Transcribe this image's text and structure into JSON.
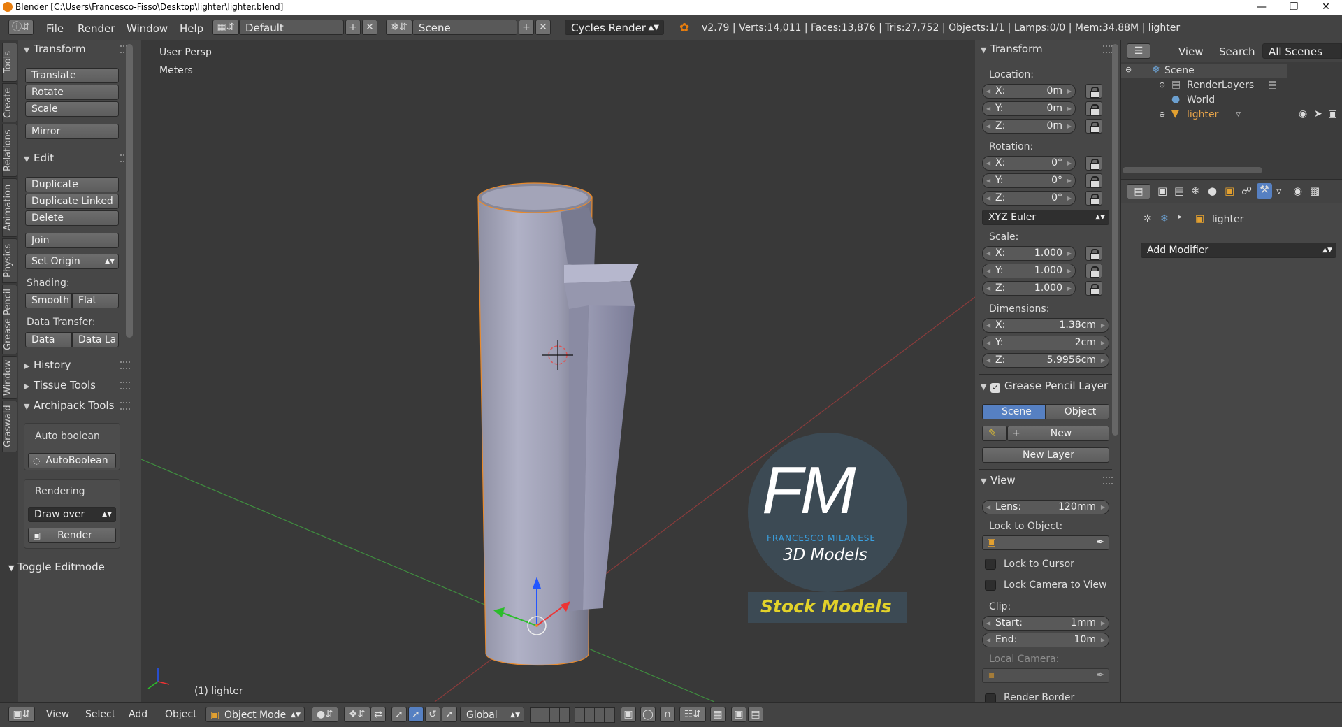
{
  "window": {
    "title": "Blender [C:\\Users\\Francesco-Fisso\\Desktop\\lighter\\lighter.blend]"
  },
  "menu": {
    "items": [
      "File",
      "Render",
      "Window",
      "Help"
    ]
  },
  "header": {
    "layout": "Default",
    "scene": "Scene",
    "engine": "Cycles Render",
    "stats": "v2.79 | Verts:14,011 | Faces:13,876 | Tris:27,752 | Objects:1/1 | Lamps:0/0 | Mem:34.88M | lighter"
  },
  "tool_tabs": [
    "Tools",
    "Create",
    "Relations",
    "Animation",
    "Physics",
    "Grease Pencil",
    "Window",
    "Graswald"
  ],
  "tools": {
    "transform": {
      "title": "Transform",
      "buttons": [
        "Translate",
        "Rotate",
        "Scale",
        "Mirror"
      ]
    },
    "edit": {
      "title": "Edit",
      "buttons": [
        "Duplicate",
        "Duplicate Linked",
        "Delete",
        "Join"
      ],
      "set_origin": "Set Origin",
      "shading_label": "Shading:",
      "smooth": "Smooth",
      "flat": "Flat",
      "data_transfer_label": "Data Transfer:",
      "data": "Data",
      "data_la": "Data La"
    },
    "history": "History",
    "tissue": "Tissue Tools",
    "archipack": {
      "title": "Archipack Tools",
      "auto_boolean_label": "Auto boolean",
      "auto_boolean_btn": "AutoBoolean",
      "rendering_label": "Rendering",
      "draw_over": "Draw over",
      "render_btn": "Render"
    },
    "toggle_editmode": "Toggle Editmode"
  },
  "viewport": {
    "persp": "User Persp",
    "units": "Meters",
    "object_label": "(1) lighter",
    "watermark": {
      "logo": "FM",
      "name": "FRANCESCO MILANESE",
      "sub": "3D Models",
      "banner": "Stock Models"
    }
  },
  "npanel": {
    "transform_title": "Transform",
    "location_label": "Location:",
    "location": [
      {
        "k": "X:",
        "v": "0m"
      },
      {
        "k": "Y:",
        "v": "0m"
      },
      {
        "k": "Z:",
        "v": "0m"
      }
    ],
    "rotation_label": "Rotation:",
    "rotation": [
      {
        "k": "X:",
        "v": "0°"
      },
      {
        "k": "Y:",
        "v": "0°"
      },
      {
        "k": "Z:",
        "v": "0°"
      }
    ],
    "rotation_mode": "XYZ Euler",
    "scale_label": "Scale:",
    "scale": [
      {
        "k": "X:",
        "v": "1.000"
      },
      {
        "k": "Y:",
        "v": "1.000"
      },
      {
        "k": "Z:",
        "v": "1.000"
      }
    ],
    "dimensions_label": "Dimensions:",
    "dimensions": [
      {
        "k": "X:",
        "v": "1.38cm"
      },
      {
        "k": "Y:",
        "v": "2cm"
      },
      {
        "k": "Z:",
        "v": "5.9956cm"
      }
    ],
    "grease_title": "Grease Pencil Layer",
    "scene_tab": "Scene",
    "object_tab": "Object",
    "new_btn": "New",
    "new_layer_btn": "New Layer",
    "view_title": "View",
    "lens": {
      "k": "Lens:",
      "v": "120mm"
    },
    "lock_object_label": "Lock to Object:",
    "lock_cursor": "Lock to Cursor",
    "lock_camera": "Lock Camera to View",
    "clip_label": "Clip:",
    "clip_start": {
      "k": "Start:",
      "v": "1mm"
    },
    "clip_end": {
      "k": "End:",
      "v": "10m"
    },
    "local_camera_label": "Local Camera:",
    "render_border": "Render Border"
  },
  "outliner": {
    "view": "View",
    "search": "Search",
    "filter": "All Scenes",
    "items": [
      "Scene",
      "RenderLayers",
      "World",
      "lighter"
    ]
  },
  "properties": {
    "object_name": "lighter",
    "add_modifier": "Add Modifier"
  },
  "footer": {
    "view": "View",
    "select": "Select",
    "add": "Add",
    "object": "Object",
    "mode": "Object Mode",
    "orientation": "Global"
  }
}
